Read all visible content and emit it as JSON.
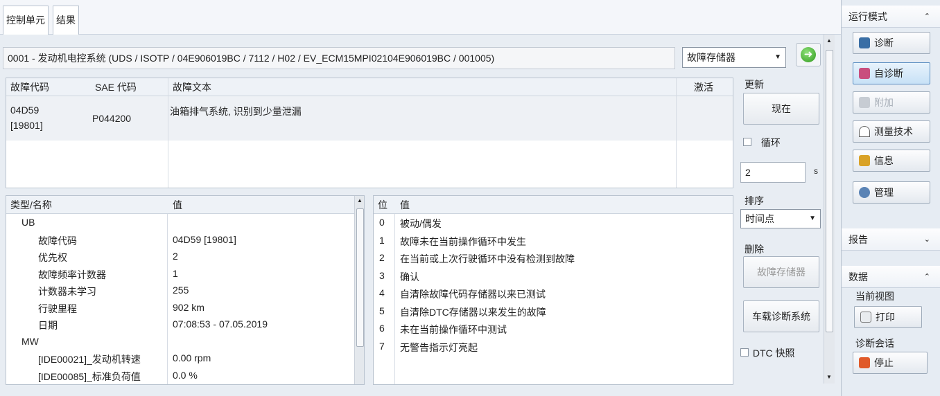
{
  "tabs": [
    "控制单元",
    "结果"
  ],
  "ecu_line": "0001 - 发动机电控系统 (UDS / ISOTP / 04E906019BC / 7112 / H02 / EV_ECM15MPI02104E906019BC / 001005)",
  "view_select": "故障存储器",
  "fault_table": {
    "headers": [
      "故障代码",
      "SAE 代码",
      "故障文本",
      "激活"
    ],
    "row": {
      "code": "04D59",
      "code2": "[19801]",
      "sae": "P044200",
      "text": "油箱排气系统, 识别到少量泄漏"
    }
  },
  "controls": {
    "update_label": "更新",
    "now_button": "现在",
    "loop_label": "循环",
    "interval_value": "2",
    "interval_unit": "s",
    "sort_label": "排序",
    "sort_select": "时间点",
    "delete_label": "删除",
    "delete_button": "故障存储器",
    "vehicle_diag_button": "车载诊断系统",
    "dtc_snapshot_label": "DTC 快照"
  },
  "detail_table": {
    "headers": [
      "类型/名称",
      "值"
    ],
    "rows": [
      {
        "name": "UB",
        "value": ""
      },
      {
        "name": "故障代码",
        "value": "04D59 [19801]"
      },
      {
        "name": "优先权",
        "value": "2"
      },
      {
        "name": "故障频率计数器",
        "value": "1"
      },
      {
        "name": "计数器未学习",
        "value": "255"
      },
      {
        "name": "行驶里程",
        "value": "902 km"
      },
      {
        "name": "日期",
        "value": "07:08:53 - 07.05.2019"
      },
      {
        "name": "MW",
        "value": ""
      },
      {
        "name": "[IDE00021]_发动机转速",
        "value": "0.00 rpm"
      },
      {
        "name": "[IDE00085]_标准负荷值",
        "value": "0.0 %"
      }
    ]
  },
  "bit_table": {
    "headers": [
      "位",
      "值"
    ],
    "rows": [
      {
        "bit": "0",
        "value": "被动/偶发"
      },
      {
        "bit": "1",
        "value": "故障未在当前操作循环中发生"
      },
      {
        "bit": "2",
        "value": "在当前或上次行驶循环中没有检测到故障"
      },
      {
        "bit": "3",
        "value": "确认"
      },
      {
        "bit": "4",
        "value": "自清除故障代码存储器以来已测试"
      },
      {
        "bit": "5",
        "value": "自清除DTC存储器以来发生的故障"
      },
      {
        "bit": "6",
        "value": "未在当前操作循环中测试"
      },
      {
        "bit": "7",
        "value": "无警告指示灯亮起"
      }
    ]
  },
  "sidebar": {
    "run_mode_title": "运行模式",
    "run_mode_buttons": [
      "诊断",
      "自诊断",
      "附加",
      "测量技术",
      "信息",
      "管理"
    ],
    "report_title": "报告",
    "data_title": "数据",
    "current_view_label": "当前视图",
    "print_button": "打印",
    "session_label": "诊断会话",
    "stop_button": "停止"
  }
}
